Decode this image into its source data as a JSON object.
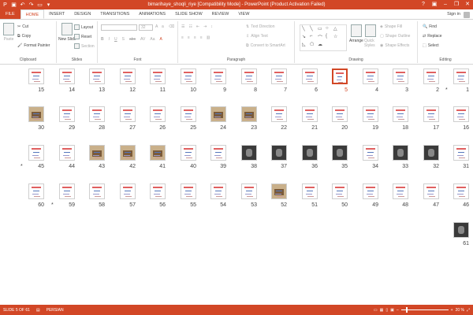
{
  "titlebar": {
    "title": "bimarihaye_shoqli_riye [Compatibility Mode] - PowerPoint (Product Activation Failed)",
    "qat_icons": [
      "powerpoint-logo-icon",
      "save-icon",
      "undo-icon",
      "redo-icon",
      "start-slideshow-icon",
      "customize-icon"
    ],
    "window_controls": [
      "?",
      "ribbon-display-icon",
      "minimize-icon",
      "restore-icon",
      "close-icon"
    ]
  },
  "tabs": [
    {
      "label": "FILE"
    },
    {
      "label": "HOME"
    },
    {
      "label": "INSERT"
    },
    {
      "label": "DESIGN"
    },
    {
      "label": "TRANSITIONS"
    },
    {
      "label": "ANIMATIONS"
    },
    {
      "label": "SLIDE SHOW"
    },
    {
      "label": "REVIEW"
    },
    {
      "label": "VIEW"
    }
  ],
  "signin": "Sign in",
  "ribbon": {
    "clipboard": {
      "label": "Clipboard",
      "paste": "Paste",
      "cut": "Cut",
      "copy": "Copy",
      "format_painter": "Format Painter"
    },
    "slides": {
      "label": "Slides",
      "new_slide": "New Slide",
      "layout": "Layout",
      "reset": "Reset",
      "section": "Section"
    },
    "font": {
      "label": "Font",
      "size": "32"
    },
    "paragraph": {
      "label": "Paragraph",
      "text_direction": "Text Direction",
      "align_text": "Align Text",
      "convert_smartart": "Convert to SmartArt"
    },
    "drawing": {
      "label": "Drawing",
      "arrange": "Arrange",
      "quick_styles": "Quick Styles",
      "shape_fill": "Shape Fill",
      "shape_outline": "Shape Outline",
      "shape_effects": "Shape Effects"
    },
    "editing": {
      "label": "Editing",
      "find": "Find",
      "replace": "Replace",
      "select": "Select"
    }
  },
  "slides": [
    {
      "n": "1",
      "star": true,
      "kind": "doc"
    },
    {
      "n": "2",
      "kind": "doc"
    },
    {
      "n": "3",
      "kind": "doc"
    },
    {
      "n": "4",
      "kind": "doc"
    },
    {
      "n": "5",
      "kind": "doc",
      "selected": true
    },
    {
      "n": "6",
      "kind": "doc"
    },
    {
      "n": "7",
      "kind": "doc"
    },
    {
      "n": "8",
      "kind": "doc"
    },
    {
      "n": "9",
      "kind": "doc"
    },
    {
      "n": "10",
      "kind": "doc"
    },
    {
      "n": "11",
      "kind": "doc"
    },
    {
      "n": "12",
      "kind": "doc"
    },
    {
      "n": "13",
      "kind": "doc"
    },
    {
      "n": "14",
      "kind": "doc"
    },
    {
      "n": "15",
      "kind": "doc"
    },
    {
      "n": "16",
      "kind": "doc"
    },
    {
      "n": "17",
      "kind": "doc"
    },
    {
      "n": "18",
      "kind": "doc"
    },
    {
      "n": "19",
      "kind": "doc"
    },
    {
      "n": "20",
      "kind": "doc"
    },
    {
      "n": "21",
      "kind": "doc"
    },
    {
      "n": "22",
      "kind": "doc"
    },
    {
      "n": "23",
      "kind": "img"
    },
    {
      "n": "24",
      "kind": "img"
    },
    {
      "n": "25",
      "kind": "doc"
    },
    {
      "n": "26",
      "kind": "doc"
    },
    {
      "n": "27",
      "kind": "doc"
    },
    {
      "n": "28",
      "kind": "doc"
    },
    {
      "n": "29",
      "kind": "doc"
    },
    {
      "n": "30",
      "kind": "img"
    },
    {
      "n": "31",
      "kind": "doc"
    },
    {
      "n": "32",
      "kind": "photo"
    },
    {
      "n": "33",
      "kind": "photo"
    },
    {
      "n": "34",
      "kind": "doc"
    },
    {
      "n": "35",
      "kind": "photo"
    },
    {
      "n": "36",
      "kind": "photo"
    },
    {
      "n": "37",
      "kind": "photo"
    },
    {
      "n": "38",
      "kind": "photo"
    },
    {
      "n": "39",
      "kind": "doc"
    },
    {
      "n": "40",
      "kind": "doc"
    },
    {
      "n": "41",
      "kind": "img"
    },
    {
      "n": "42",
      "kind": "img"
    },
    {
      "n": "43",
      "kind": "img"
    },
    {
      "n": "44",
      "kind": "doc"
    },
    {
      "n": "45",
      "star": true,
      "kind": "doc"
    },
    {
      "n": "46",
      "kind": "doc"
    },
    {
      "n": "47",
      "kind": "doc"
    },
    {
      "n": "48",
      "kind": "doc"
    },
    {
      "n": "49",
      "kind": "doc"
    },
    {
      "n": "50",
      "kind": "doc"
    },
    {
      "n": "51",
      "kind": "doc"
    },
    {
      "n": "52",
      "kind": "img"
    },
    {
      "n": "53",
      "kind": "doc"
    },
    {
      "n": "54",
      "kind": "doc"
    },
    {
      "n": "55",
      "kind": "doc"
    },
    {
      "n": "56",
      "kind": "doc"
    },
    {
      "n": "57",
      "kind": "doc"
    },
    {
      "n": "58",
      "kind": "doc"
    },
    {
      "n": "59",
      "star": true,
      "kind": "doc"
    },
    {
      "n": "60",
      "kind": "doc"
    },
    {
      "n": "61",
      "kind": "photo"
    }
  ],
  "status": {
    "slide_info": "SLIDE 5 OF 61",
    "language": "PERSIAN",
    "zoom": "20 %",
    "zoom_fraction": 0.2
  }
}
